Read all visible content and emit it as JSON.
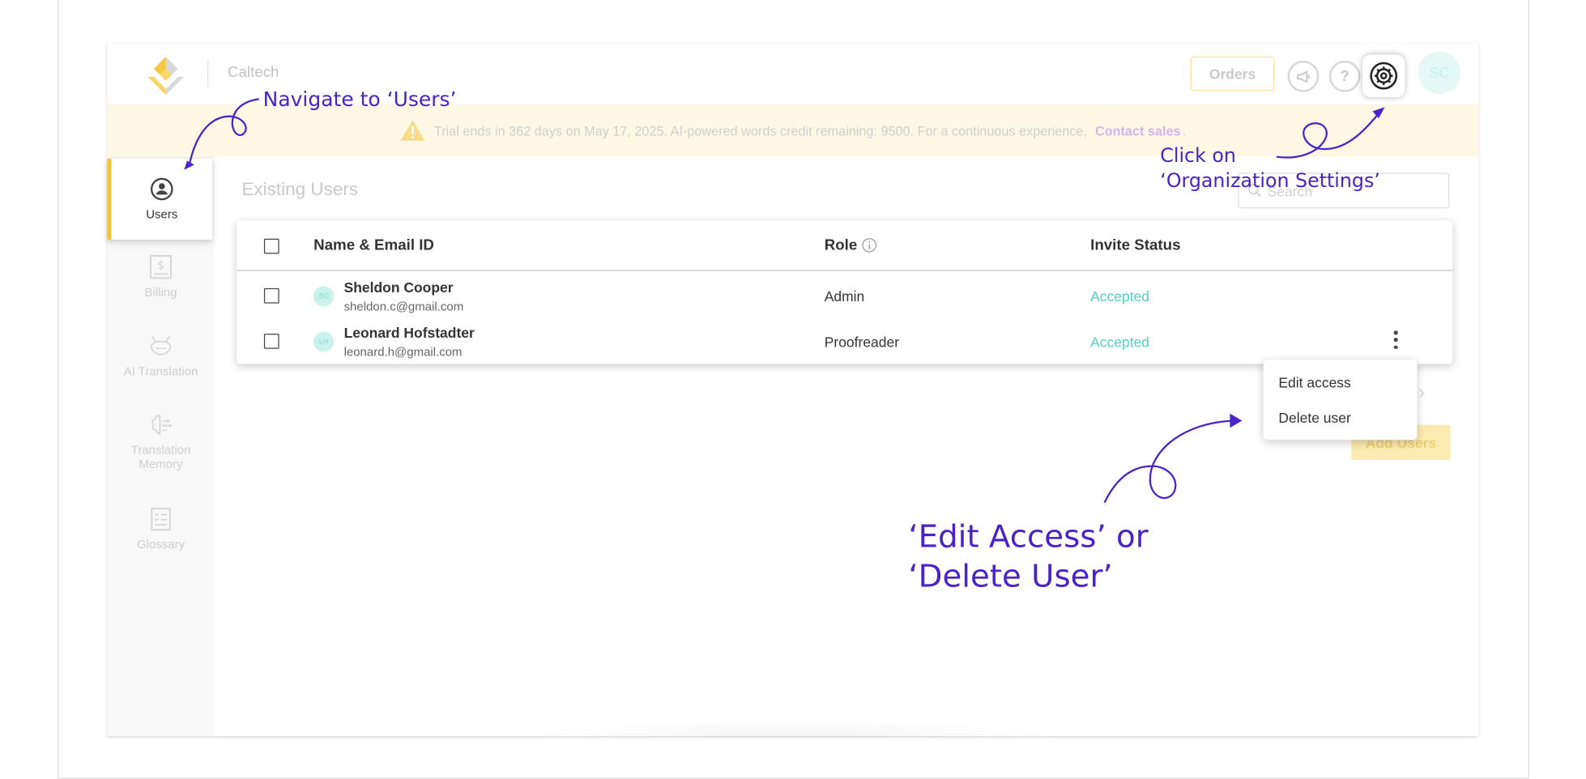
{
  "header": {
    "org_name": "Caltech",
    "orders_label": "Orders",
    "help_glyph": "?",
    "avatar_initials": "SC",
    "icons": [
      "announcement-icon",
      "help-icon",
      "gear-icon"
    ]
  },
  "banner": {
    "message": "Trial ends in 362 days on May 17, 2025. AI-powered words credit remaining: 9500. For a continuous experience,",
    "link": "Contact sales",
    "suffix": ".",
    "icon": "warning-icon"
  },
  "sidebar": {
    "items": [
      {
        "label": "Users",
        "icon": "user-circle-icon",
        "active": true
      },
      {
        "label": "Billing",
        "icon": "billing-icon",
        "active": false
      },
      {
        "label": "AI Translation",
        "icon": "robot-icon",
        "active": false
      },
      {
        "label": "Translation Memory",
        "icon": "brain-icon",
        "active": false
      },
      {
        "label": "Glossary",
        "icon": "glossary-icon",
        "active": false
      }
    ]
  },
  "main": {
    "title": "Existing Users",
    "search_placeholder": "Search",
    "columns": {
      "name": "Name & Email ID",
      "role": "Role",
      "status": "Invite Status"
    },
    "users": [
      {
        "initials": "SC",
        "name": "Sheldon Cooper",
        "email": "sheldon.c@gmail.com",
        "role": "Admin",
        "status": "Accepted"
      },
      {
        "initials": "LH",
        "name": "Leonard Hofstadter",
        "email": "leonard.h@gmail.com",
        "role": "Proofreader",
        "status": "Accepted"
      }
    ],
    "row_menu": {
      "edit": "Edit access",
      "delete": "Delete user"
    },
    "add_users_label": "Add Users",
    "pager_glyph": "›"
  },
  "annotations": {
    "step1": "Navigate to ‘Users’",
    "step2_line1": "Click on",
    "step2_line2": "‘Organization Settings’",
    "step3_line1": "‘Edit Access’ or",
    "step3_line2": "‘Delete User’"
  },
  "colors": {
    "accent_yellow": "#f6c23c",
    "annotation_purple": "#4a22c9",
    "status_green": "#52d3c0"
  }
}
